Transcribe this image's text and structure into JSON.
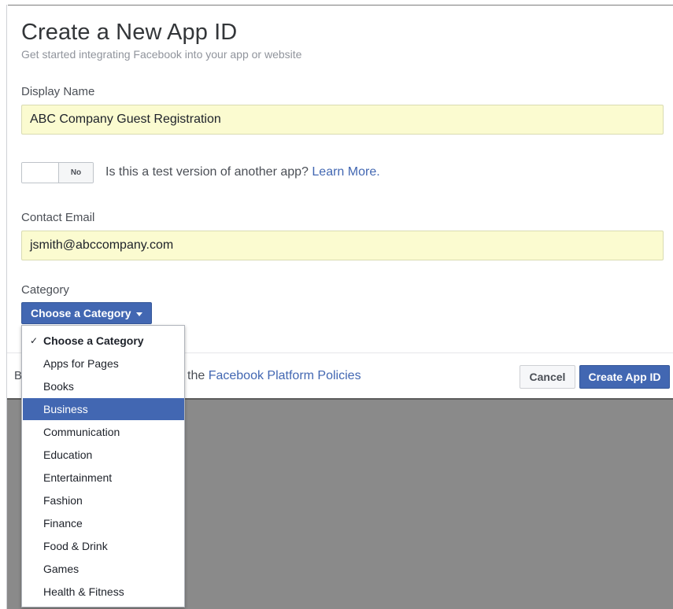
{
  "dialog": {
    "title": "Create a New App ID",
    "subtitle": "Get started integrating Facebook into your app or website"
  },
  "display_name": {
    "label": "Display Name",
    "value": "ABC Company Guest Registration"
  },
  "test_version": {
    "toggle_state": "No",
    "question": "Is this a test version of another app?",
    "learn_more": "Learn More."
  },
  "contact_email": {
    "label": "Contact Email",
    "value": "jsmith@abccompany.com"
  },
  "category": {
    "label": "Category",
    "button_label": "Choose a Category",
    "check_mark": "✓",
    "options": [
      {
        "label": "Choose a Category",
        "selected": true
      },
      {
        "label": "Apps for Pages"
      },
      {
        "label": "Books"
      },
      {
        "label": "Business",
        "highlighted": true
      },
      {
        "label": "Communication"
      },
      {
        "label": "Education"
      },
      {
        "label": "Entertainment"
      },
      {
        "label": "Fashion"
      },
      {
        "label": "Finance"
      },
      {
        "label": "Food & Drink"
      },
      {
        "label": "Games"
      },
      {
        "label": "Health & Fitness"
      }
    ]
  },
  "footer": {
    "partial_text_left": "B",
    "partial_text_right": "the",
    "policy_link": "Facebook Platform Policies",
    "cancel_label": "Cancel",
    "create_label": "Create App ID"
  },
  "colors": {
    "brand_blue": "#4267b2",
    "field_fill": "#fbfbd0",
    "backdrop": "#8a8a8a"
  }
}
